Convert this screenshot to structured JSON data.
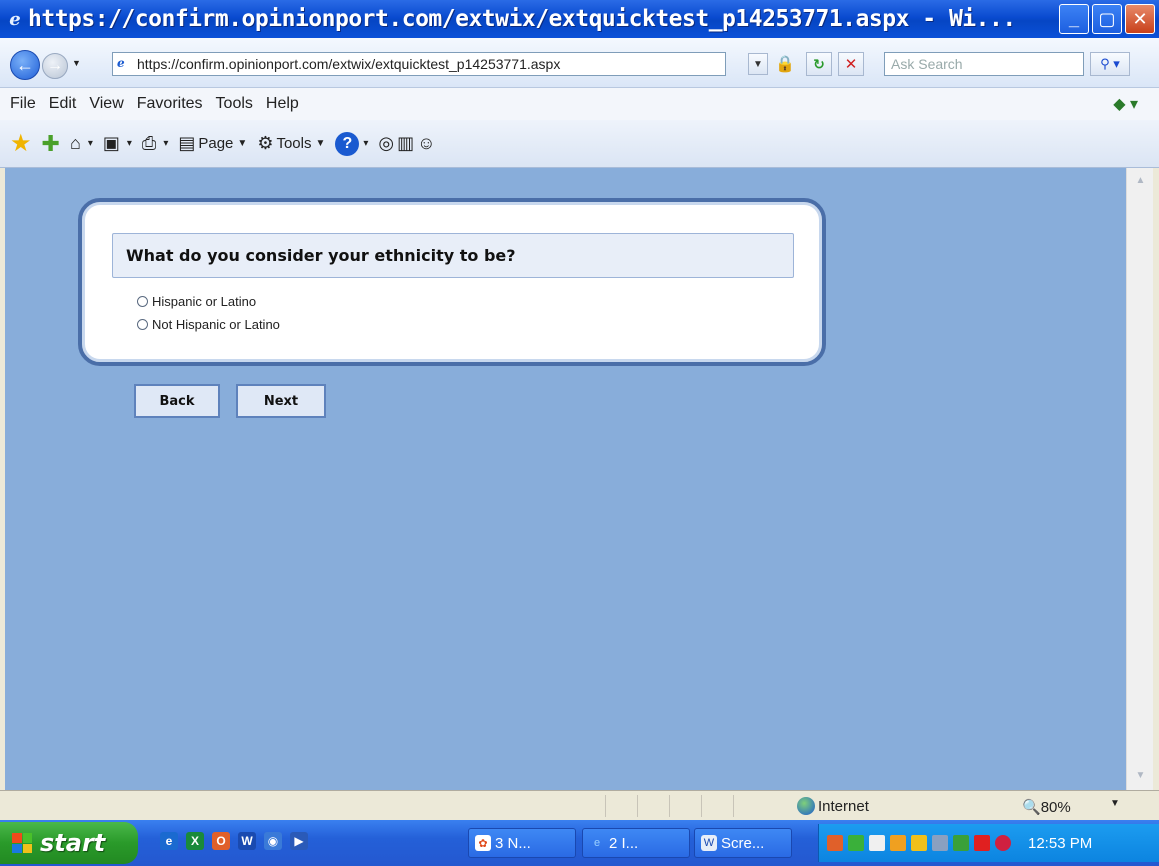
{
  "window": {
    "title": "https://confirm.opinionport.com/extwix/extquicktest_p14253771.aspx - Wi...",
    "minimize": "_",
    "maximize": "▢",
    "close": "✕"
  },
  "address_bar": {
    "url": "https://confirm.opinionport.com/extwix/extquicktest_p14253771.aspx",
    "search_placeholder": "Ask Search"
  },
  "menu": {
    "items": [
      "File",
      "Edit",
      "View",
      "Favorites",
      "Tools",
      "Help"
    ]
  },
  "toolbar": {
    "page_label": "Page",
    "tools_label": "Tools"
  },
  "survey": {
    "question": "What do you consider your ethnicity to be?",
    "options": [
      "Hispanic or Latino",
      "Not Hispanic or Latino"
    ],
    "back_label": "Back",
    "next_label": "Next"
  },
  "status": {
    "zone": "Internet",
    "zoom": "80%"
  },
  "taskbar": {
    "start_label": "start",
    "tasks": [
      {
        "label": "3 N..."
      },
      {
        "label": "2 I..."
      },
      {
        "label": "Scre..."
      }
    ],
    "clock": "12:53 PM"
  },
  "icons": {
    "back": "arrow-left-icon",
    "forward": "arrow-right-icon",
    "lock": "lock-icon",
    "refresh": "refresh-icon",
    "stop": "stop-icon",
    "search": "search-icon",
    "favorites": "star-icon",
    "add_favorites": "add-favorite-icon",
    "home": "home-icon",
    "feeds": "rss-icon",
    "print": "print-icon",
    "help": "help-icon",
    "globe": "globe-icon"
  },
  "colors": {
    "title_bar": "#0a4bd0",
    "content_bg": "#88adda",
    "card_border": "#4a6ea8",
    "start_green": "#2a9a2a"
  }
}
